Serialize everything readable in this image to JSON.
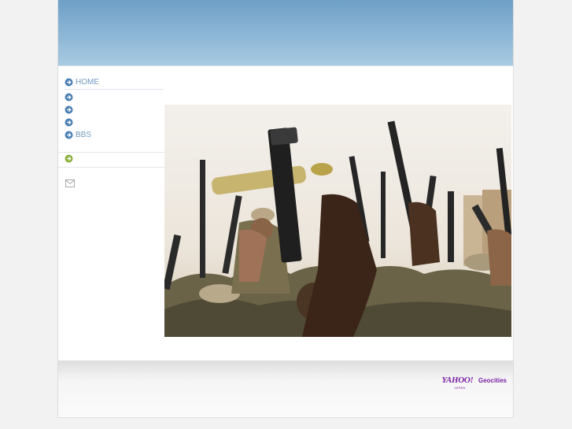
{
  "nav": {
    "items": [
      {
        "label": "HOME"
      },
      {
        "label": ""
      },
      {
        "label": ""
      },
      {
        "label": ""
      },
      {
        "label": "BBS"
      }
    ]
  },
  "footer": {
    "logo_brand": "YAHOO!",
    "logo_sub": "JAPAN",
    "logo_product": "Geocities"
  },
  "colors": {
    "banner": "#8db7d6",
    "nav_link": "#6f99bf",
    "nav_icon": "#4a7fb5",
    "green_icon": "#8ab23c",
    "logo": "#7b1fa2"
  },
  "icons": {
    "nav": "arrow-circle-icon",
    "extra": "green-arrow-icon",
    "mail": "mail-icon"
  }
}
